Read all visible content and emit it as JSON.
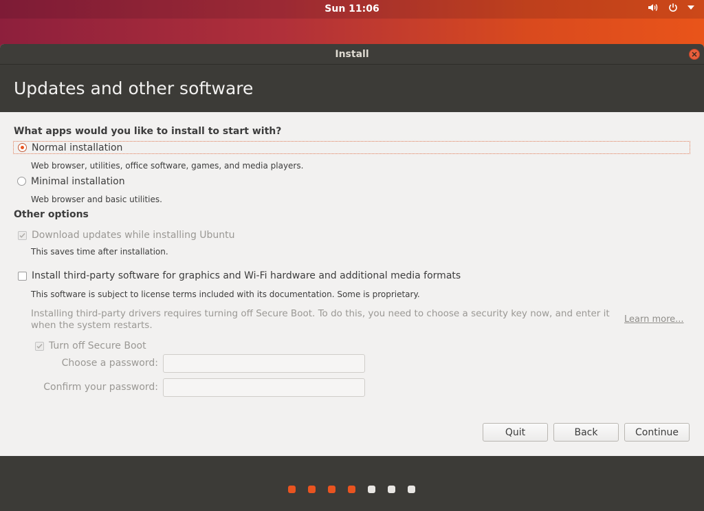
{
  "topbar": {
    "clock": "Sun 11:06"
  },
  "window": {
    "title": "Install"
  },
  "page": {
    "title": "Updates and other software"
  },
  "apps": {
    "heading": "What apps would you like to install to start with?",
    "normal_label": "Normal installation",
    "normal_desc": "Web browser, utilities, office software, games, and media players.",
    "minimal_label": "Minimal installation",
    "minimal_desc": "Web browser and basic utilities."
  },
  "other": {
    "heading": "Other options",
    "updates_label": "Download updates while installing Ubuntu",
    "updates_desc": "This saves time after installation.",
    "thirdparty_label": "Install third-party software for graphics and Wi-Fi hardware and additional media formats",
    "thirdparty_desc": "This software is subject to license terms included with its documentation. Some is proprietary.",
    "secureboot_note_1": "Installing third-party drivers requires turning off Secure Boot. To do this, you need to choose a security key now, and enter it",
    "secureboot_note_2": "when the system restarts.",
    "learn_more": "Learn more...",
    "secureboot_label": "Turn off Secure Boot",
    "password_label": "Choose a password:",
    "confirm_label": "Confirm your password:"
  },
  "buttons": {
    "quit": "Quit",
    "back": "Back",
    "continue": "Continue"
  },
  "progress": {
    "total_steps": 7,
    "completed_steps": 4
  },
  "colors": {
    "accent": "#e95420",
    "header": "#3c3b37",
    "dot_inactive": "#e8e6e3"
  }
}
